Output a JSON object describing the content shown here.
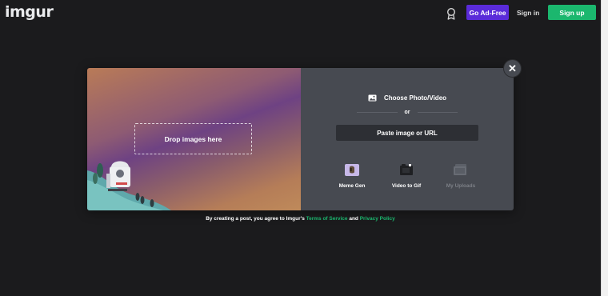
{
  "header": {
    "logo": "imgur",
    "award_icon": "award-ribbon-icon",
    "go_ad_free": "Go Ad-Free",
    "sign_in": "Sign in",
    "sign_up": "Sign up"
  },
  "modal": {
    "drop_label": "Drop images here",
    "choose_label": "Choose Photo/Video",
    "or_label": "or",
    "paste_label": "Paste image or URL",
    "tools": [
      {
        "label": "Meme Gen",
        "icon": "meme-gen-icon",
        "enabled": true
      },
      {
        "label": "Video to Gif",
        "icon": "video-to-gif-icon",
        "enabled": true
      },
      {
        "label": "My Uploads",
        "icon": "my-uploads-icon",
        "enabled": false
      }
    ],
    "close_glyph": "✕"
  },
  "footer": {
    "prefix": "By creating a post, you agree to Imgur's ",
    "terms_link": "Terms of Service",
    "and": " and ",
    "privacy_link": "Privacy Policy"
  },
  "colors": {
    "background": "#1b1b1d",
    "ad_free": "#5a2bd9",
    "sign_up": "#1bb76e",
    "panel": "#474a51",
    "link": "#1bb76e"
  }
}
